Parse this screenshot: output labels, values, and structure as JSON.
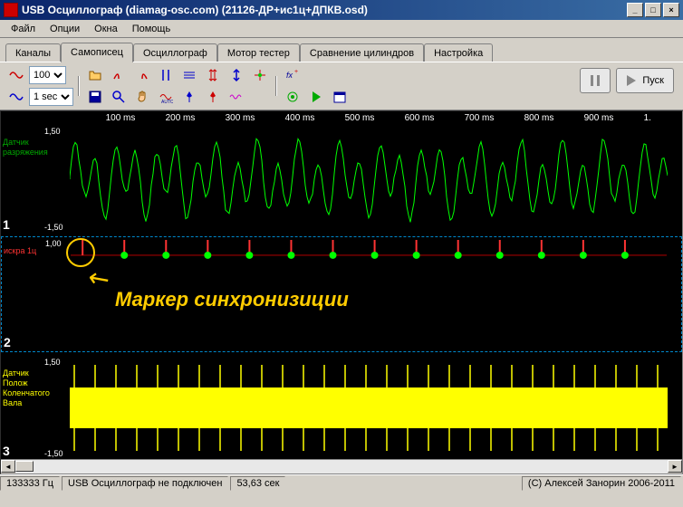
{
  "window": {
    "title": "USB Осциллограф (diamag-osc.com) (21126-ДР+ис1ц+ДПКВ.osd)"
  },
  "menu": [
    "Файл",
    "Опции",
    "Окна",
    "Помощь"
  ],
  "tabs": [
    "Каналы",
    "Самописец",
    "Осциллограф",
    "Мотор тестер",
    "Сравнение цилиндров",
    "Настройка"
  ],
  "active_tab": 1,
  "toolbar": {
    "scale_options": [
      "100"
    ],
    "scale_value": "100",
    "time_options": [
      "1 sec"
    ],
    "time_value": "1 sec",
    "play_label": "Пуск"
  },
  "time_axis": [
    "100 ms",
    "200 ms",
    "300 ms",
    "400 ms",
    "500 ms",
    "600 ms",
    "700 ms",
    "800 ms",
    "900 ms",
    "1."
  ],
  "channels": {
    "ch1": {
      "label": "Датчик\nразряжения",
      "num": "1",
      "top_scale": "1,50",
      "bot_scale": "-1,50"
    },
    "ch2": {
      "label": "искра 1ц",
      "num": "2",
      "top_scale": "1,00"
    },
    "ch3": {
      "label": "Датчик\nПолож\nКоленчатого\nВала",
      "num": "3",
      "top_scale": "1,50",
      "bot_scale": "-1,50"
    }
  },
  "annotation": {
    "text": "Маркер синхронизиции"
  },
  "status": {
    "freq": "133333 Гц",
    "conn": "USB Осциллограф не подключен",
    "time": "53,63 сек",
    "copyright": "(C) Алексей Занорин 2006-2011"
  },
  "chart_data": {
    "type": "line",
    "time_range_ms": [
      0,
      1000
    ],
    "series": [
      {
        "name": "Датчик разряжения",
        "channel": 1,
        "color": "#00ff00",
        "yrange": [
          -1.5,
          1.5
        ],
        "pattern": "periodic ~30Hz oscillation between approx -1.2 and 1.4"
      },
      {
        "name": "искра 1ц",
        "channel": 2,
        "color": "#ff3333",
        "yrange": [
          0,
          1.0
        ],
        "events_ms": [
          20,
          90,
          160,
          230,
          300,
          370,
          440,
          510,
          580,
          650,
          720,
          790,
          860,
          930
        ],
        "markers_ms": [
          90,
          160,
          230,
          300,
          370,
          440,
          510,
          580,
          650,
          720,
          790,
          860,
          930
        ],
        "marker_color": "#00ff00"
      },
      {
        "name": "Датчик Полож Коленчатого Вала",
        "channel": 3,
        "color": "#ffff00",
        "yrange": [
          -1.5,
          1.5
        ],
        "pattern": "dense bipolar pulse train ~±1.0 with periodic ~1.5 spikes every ~35ms"
      }
    ]
  }
}
